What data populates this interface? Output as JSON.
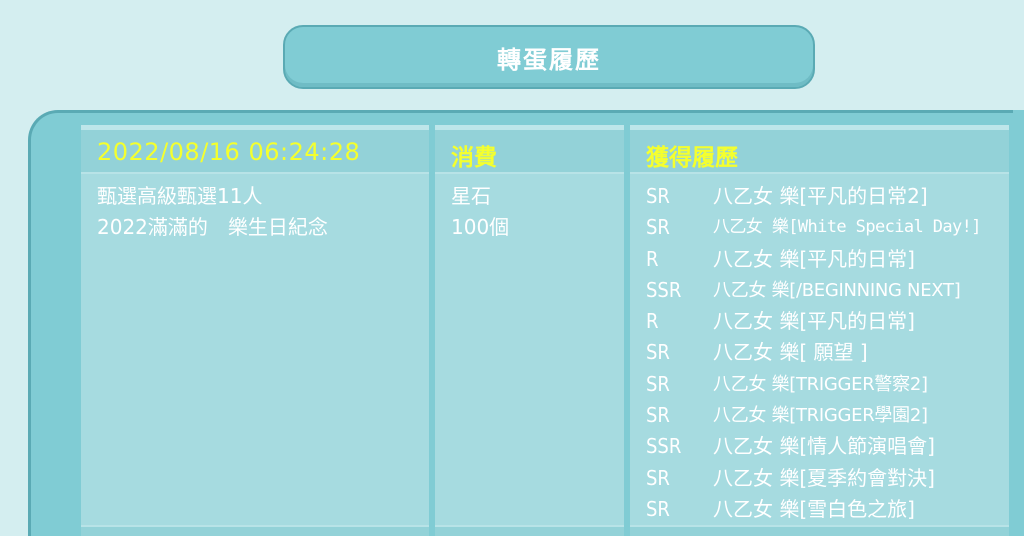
{
  "title": "轉蛋履歷",
  "record": {
    "timestamp": "2022/08/16 06:24:28",
    "description_lines": [
      "甄選高級甄選11人",
      "2022滿滿的　樂生日紀念"
    ]
  },
  "cost": {
    "header": "消費",
    "lines": [
      "星石",
      "100個"
    ]
  },
  "results": {
    "header": "獲得履歷",
    "items": [
      {
        "rarity": "SR",
        "name": "八乙女 樂[平凡的日常2]"
      },
      {
        "rarity": "SR",
        "name": "八乙女 樂[White Special Day!]"
      },
      {
        "rarity": "R",
        "name": "八乙女 樂[平凡的日常]"
      },
      {
        "rarity": "SSR",
        "name": "八乙女 樂[/BEGINNING NEXT]"
      },
      {
        "rarity": "R",
        "name": "八乙女 樂[平凡的日常]"
      },
      {
        "rarity": "SR",
        "name": "八乙女 樂[ 願望 ]"
      },
      {
        "rarity": "SR",
        "name": "八乙女 樂[TRIGGER警察2]"
      },
      {
        "rarity": "SR",
        "name": "八乙女 樂[TRIGGER學園2]"
      },
      {
        "rarity": "SSR",
        "name": "八乙女 樂[情人節演唱會]"
      },
      {
        "rarity": "SR",
        "name": "八乙女 樂[夏季約會對決]"
      },
      {
        "rarity": "SR",
        "name": "八乙女 樂[雪白色之旅]"
      }
    ]
  },
  "colors": {
    "background": "#d4eef0",
    "panel": "#80ccd4",
    "cell": "#a6dbe0",
    "header_text": "#f4ff2e",
    "body_text": "#ffffff"
  }
}
